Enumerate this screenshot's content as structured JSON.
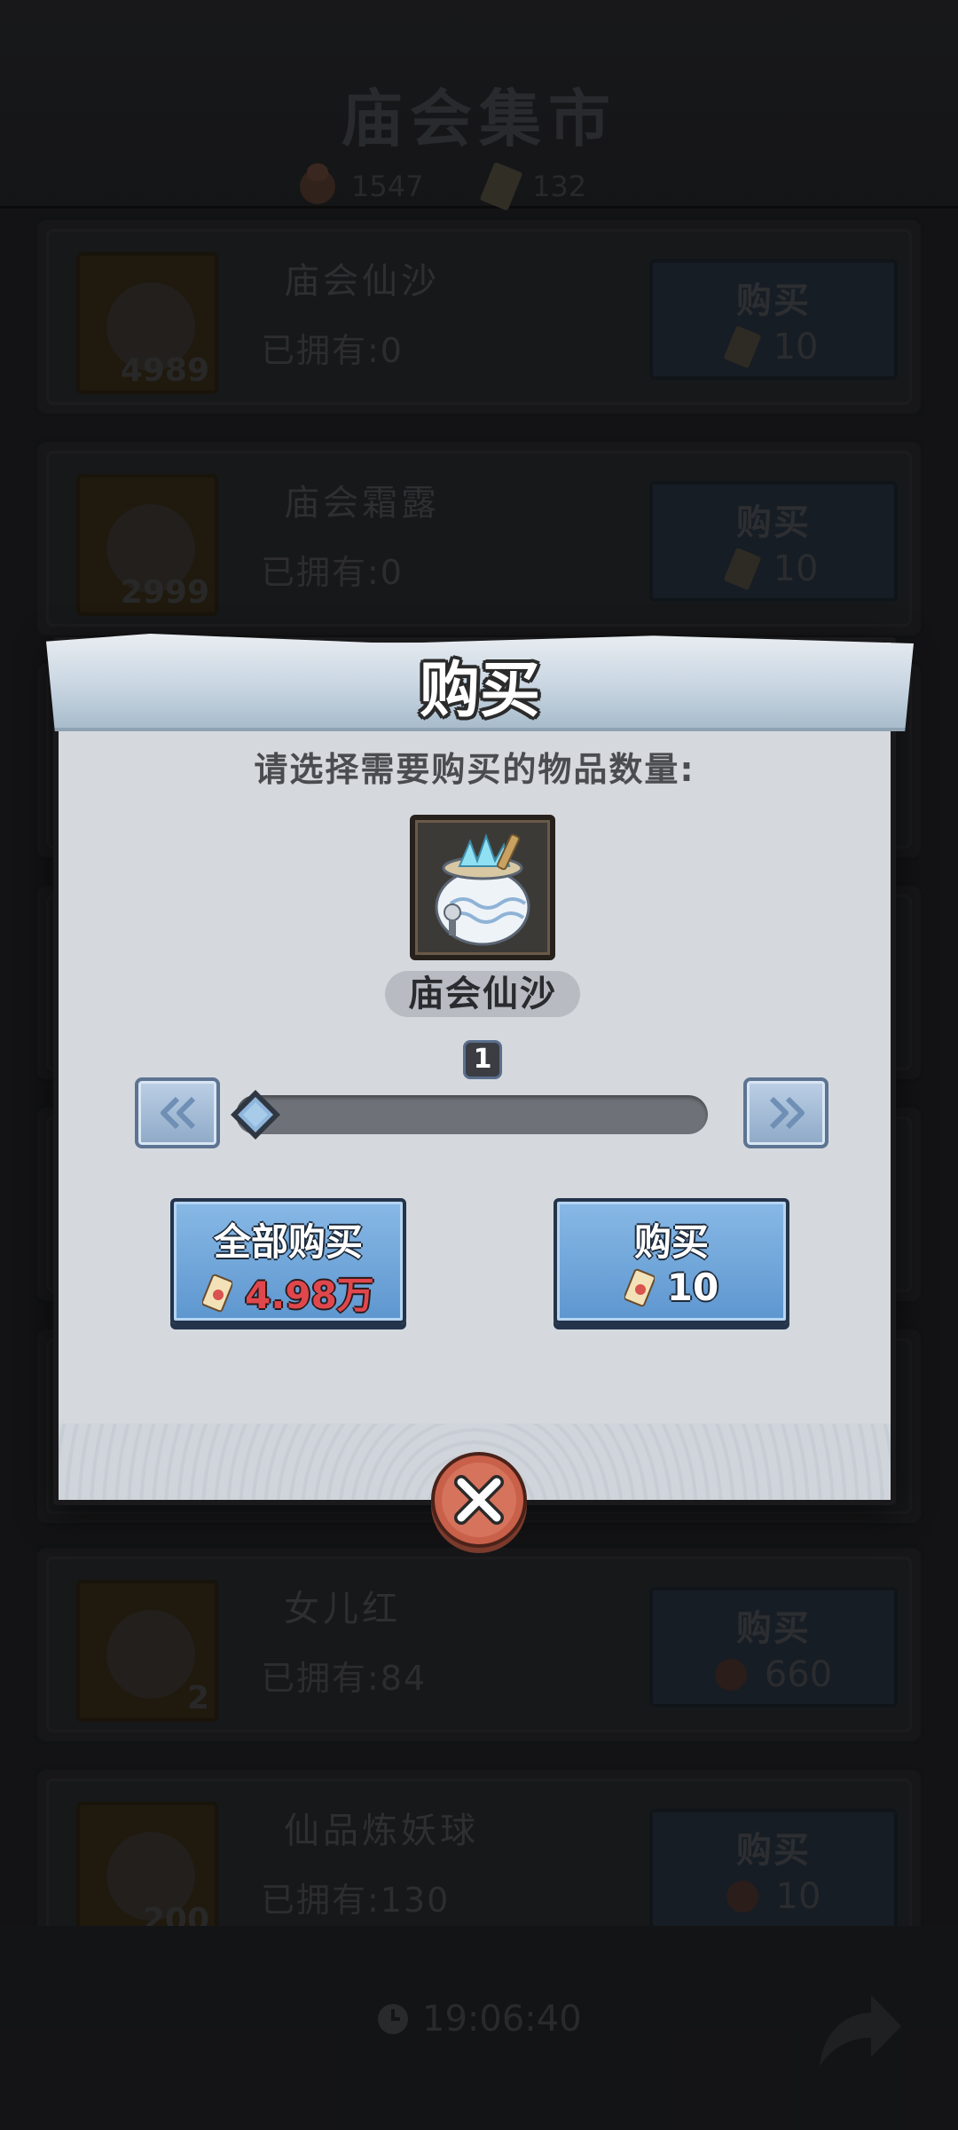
{
  "shop": {
    "title": "庙会集市",
    "currency_a": "1547",
    "currency_b": "132",
    "items": [
      {
        "name": "庙会仙沙",
        "owned": "已拥有:0",
        "count": "4989",
        "buy_label": "购买",
        "price": "10",
        "price_icon": "ticket"
      },
      {
        "name": "庙会霜露",
        "owned": "已拥有:0",
        "count": "2999",
        "buy_label": "购买",
        "price": "10",
        "price_icon": "ticket"
      },
      {
        "name": "女儿红",
        "owned": "已拥有:84",
        "count": "2",
        "buy_label": "购买",
        "price": "660",
        "price_icon": "coin"
      },
      {
        "name": "仙品炼妖球",
        "owned": "已拥有:130",
        "count": "200",
        "buy_label": "购买",
        "price": "10",
        "price_icon": "coin"
      }
    ],
    "timer": "19:06:40"
  },
  "dialog": {
    "title": "购买",
    "prompt": "请选择需要购买的物品数量:",
    "item_name": "庙会仙沙",
    "quantity": "1",
    "slider_fraction": 0.0,
    "buy_all": {
      "label": "全部购买",
      "price": "4.98万"
    },
    "buy": {
      "label": "购买",
      "price": "10"
    }
  },
  "colors": {
    "button_blue": "#5d96cf",
    "price_red": "#e0474c",
    "close_red": "#c8604a"
  },
  "icons": [
    "coin-icon",
    "ticket-icon",
    "clock-icon",
    "share-arrow-icon",
    "double-left-arrow-icon",
    "double-right-arrow-icon",
    "close-x-icon"
  ]
}
